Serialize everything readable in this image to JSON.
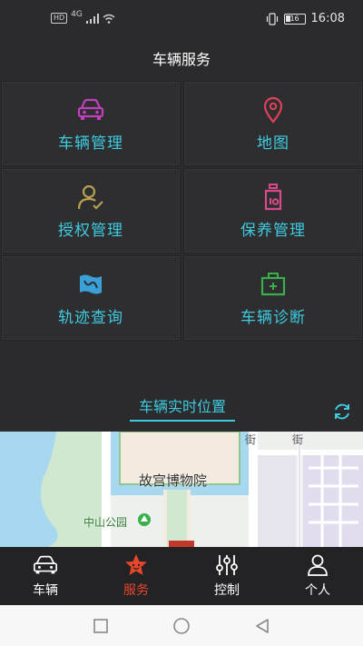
{
  "status_bar": {
    "network_hd": "HD",
    "network_gen": "4G",
    "battery": "16",
    "time": "16:08"
  },
  "header": {
    "title": "车辆服务"
  },
  "grid": [
    {
      "label": "车辆管理",
      "icon": "car-icon",
      "color": "#c040c0"
    },
    {
      "label": "地图",
      "icon": "map-pin-icon",
      "color": "#e0405a"
    },
    {
      "label": "授权管理",
      "icon": "user-check-icon",
      "color": "#b8a050"
    },
    {
      "label": "保养管理",
      "icon": "oil-can-icon",
      "color": "#d84a8a"
    },
    {
      "label": "轨迹查询",
      "icon": "route-map-icon",
      "color": "#3aa0d8"
    },
    {
      "label": "车辆诊断",
      "icon": "medical-kit-icon",
      "color": "#3ab04a"
    }
  ],
  "realtime": {
    "title": "车辆实时位置",
    "refresh_icon": "refresh-icon"
  },
  "map": {
    "poi_main": "故宫博物院",
    "poi_park": "中山公园",
    "street_1": "街",
    "street_2": "街"
  },
  "bottom_nav": [
    {
      "label": "车辆",
      "icon": "car-outline-icon",
      "active": false
    },
    {
      "label": "服务",
      "icon": "star-icon",
      "active": true
    },
    {
      "label": "控制",
      "icon": "sliders-icon",
      "active": false
    },
    {
      "label": "个人",
      "icon": "person-icon",
      "active": false
    }
  ],
  "colors": {
    "accent": "#3ecbe0",
    "active_tab": "#e8462b",
    "background": "#2b2b2d"
  }
}
